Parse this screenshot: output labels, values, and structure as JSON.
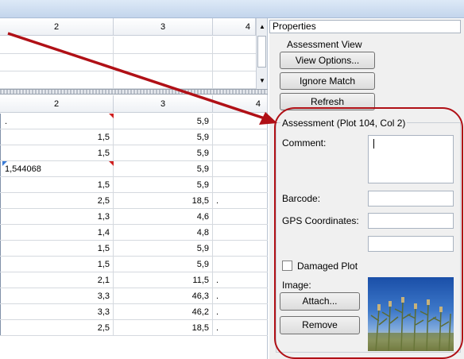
{
  "grid": {
    "top_headers": [
      "2",
      "3",
      "4"
    ],
    "bottom_headers": [
      "2",
      "3",
      "4"
    ],
    "rows": [
      {
        "c2": ".",
        "c3": "5,9",
        "c4": ""
      },
      {
        "c2": "1,5",
        "c3": "5,9",
        "c4": ""
      },
      {
        "c2": "1,5",
        "c3": "5,9",
        "c4": ""
      },
      {
        "c2": "1,544068",
        "c3": "5,9",
        "c4": ""
      },
      {
        "c2": "1,5",
        "c3": "5,9",
        "c4": ""
      },
      {
        "c2": "2,5",
        "c3": "18,5",
        "c4": "."
      },
      {
        "c2": "1,3",
        "c3": "4,6",
        "c4": ""
      },
      {
        "c2": "1,4",
        "c3": "4,8",
        "c4": ""
      },
      {
        "c2": "1,5",
        "c3": "5,9",
        "c4": ""
      },
      {
        "c2": "1,5",
        "c3": "5,9",
        "c4": ""
      },
      {
        "c2": "2,1",
        "c3": "11,5",
        "c4": "."
      },
      {
        "c2": "3,3",
        "c3": "46,3",
        "c4": "."
      },
      {
        "c2": "3,3",
        "c3": "46,2",
        "c4": "."
      },
      {
        "c2": "2,5",
        "c3": "18,5",
        "c4": "."
      }
    ]
  },
  "properties": {
    "title": "Properties",
    "assessment_view_label": "Assessment View",
    "view_options_label": "View Options...",
    "ignore_match_label": "Ignore Match",
    "refresh_label": "Refresh",
    "assessment_title": "Assessment",
    "assessment_context": "(Plot 104, Col 2)",
    "comment_label": "Comment:",
    "barcode_label": "Barcode:",
    "gps_label": "GPS Coordinates:",
    "damaged_plot_label": "Damaged Plot",
    "damaged_plot_checked": false,
    "image_label": "Image:",
    "attach_label": "Attach...",
    "remove_label": "Remove"
  },
  "annotation_color": "#b01016"
}
